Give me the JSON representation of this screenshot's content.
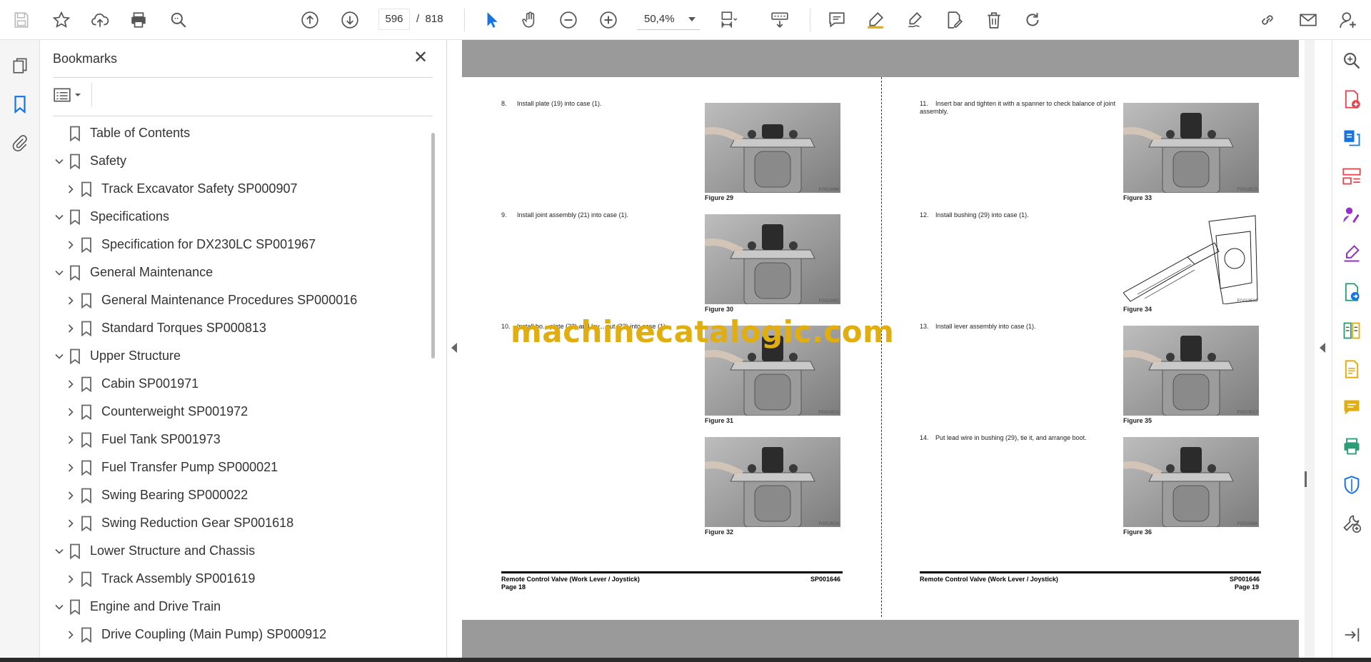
{
  "toolbar": {
    "current_page": "596",
    "page_separator": "/",
    "total_pages": "818",
    "zoom": "50,4%"
  },
  "bookmarks": {
    "title": "Bookmarks",
    "close_glyph": "✕",
    "items": [
      {
        "label": "Table of Contents",
        "level": 0,
        "expander": "none"
      },
      {
        "label": "Safety",
        "level": 0,
        "expander": "expanded"
      },
      {
        "label": "Track Excavator Safety SP000907",
        "level": 1,
        "expander": "collapsed"
      },
      {
        "label": "Specifications",
        "level": 0,
        "expander": "expanded"
      },
      {
        "label": "Specification for DX230LC SP001967",
        "level": 1,
        "expander": "collapsed"
      },
      {
        "label": "General Maintenance",
        "level": 0,
        "expander": "expanded"
      },
      {
        "label": "General Maintenance Procedures SP000016",
        "level": 1,
        "expander": "collapsed"
      },
      {
        "label": "Standard Torques SP000813",
        "level": 1,
        "expander": "collapsed"
      },
      {
        "label": "Upper Structure",
        "level": 0,
        "expander": "expanded"
      },
      {
        "label": "Cabin SP001971",
        "level": 1,
        "expander": "collapsed"
      },
      {
        "label": "Counterweight SP001972",
        "level": 1,
        "expander": "collapsed"
      },
      {
        "label": "Fuel Tank SP001973",
        "level": 1,
        "expander": "collapsed"
      },
      {
        "label": "Fuel Transfer Pump SP000021",
        "level": 1,
        "expander": "collapsed"
      },
      {
        "label": "Swing Bearing SP000022",
        "level": 1,
        "expander": "collapsed"
      },
      {
        "label": "Swing Reduction Gear SP001618",
        "level": 1,
        "expander": "collapsed"
      },
      {
        "label": "Lower Structure and Chassis",
        "level": 0,
        "expander": "expanded"
      },
      {
        "label": "Track Assembly SP001619",
        "level": 1,
        "expander": "collapsed"
      },
      {
        "label": "Engine and Drive Train",
        "level": 0,
        "expander": "expanded"
      },
      {
        "label": "Drive Coupling (Main Pump) SP000912",
        "level": 1,
        "expander": "collapsed"
      }
    ]
  },
  "document": {
    "left_page": {
      "steps": [
        {
          "num": "8.",
          "text": "Install plate (19) into case (1)."
        },
        {
          "num": "9.",
          "text": "Install joint assembly (21) into case (1)."
        },
        {
          "num": "10.",
          "text": "Install bo... plate (22) and lev... nut (23) into case (1)."
        }
      ],
      "figures": [
        {
          "caption": "Figure 29",
          "code": "FG013486"
        },
        {
          "caption": "Figure 30",
          "code": "FG013492"
        },
        {
          "caption": "Figure 31",
          "code": "FG013513"
        },
        {
          "caption": "Figure 32",
          "code": "FG013514"
        }
      ],
      "footer_title": "Remote Control Valve (Work Lever / Joystick)",
      "footer_code": "SP001646",
      "footer_page": "Page 18"
    },
    "right_page": {
      "steps": [
        {
          "num": "11.",
          "text": "Insert bar and tighten it with a spanner to check balance of joint assembly."
        },
        {
          "num": "12.",
          "text": "Install bushing (29) into case (1)."
        },
        {
          "num": "13.",
          "text": "Install lever assembly into case (1)."
        },
        {
          "num": "14.",
          "text": "Put lead wire in bushing (29), tie it, and arrange boot."
        }
      ],
      "figures": [
        {
          "caption": "Figure 33",
          "code": "FG013515"
        },
        {
          "caption": "Figure 34",
          "code": "FG013516"
        },
        {
          "caption": "Figure 35",
          "code": "FG013517"
        },
        {
          "caption": "Figure 36",
          "code": "FG013484"
        }
      ],
      "footer_title": "Remote Control Valve (Work Lever / Joystick)",
      "footer_code": "SP001646",
      "footer_page": "Page 19"
    },
    "watermark": "machinecatalogic.com"
  },
  "colors": {
    "accent_blue": "#1473e6",
    "purple": "#9b2ecb",
    "red": "#e34850",
    "yellow": "#e0ae10",
    "green": "#2d9d78",
    "gray_band": "#9a9a9a"
  }
}
